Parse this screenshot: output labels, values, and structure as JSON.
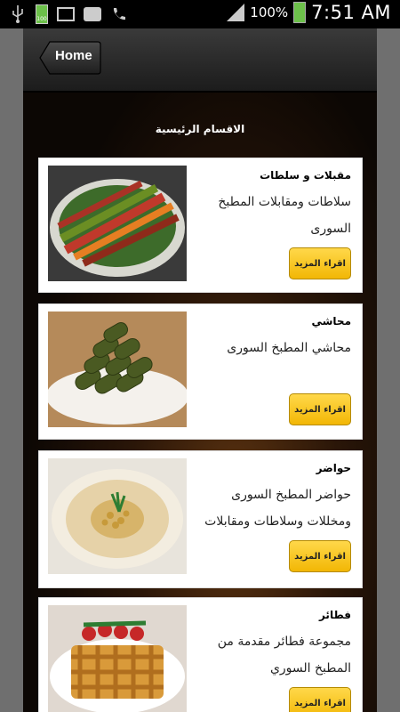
{
  "status_bar": {
    "battery_percent": "100%",
    "time": "7:51 AM",
    "small_battery_label": "100"
  },
  "header": {
    "home_label": "Home"
  },
  "section_title": "الاقسام الرئيسية",
  "categories": [
    {
      "title": "مقبلات و سلطات",
      "description": "سلاطات ومقابلات المطبخ السورى",
      "button": "اقراء المزيد",
      "image": "salad-platter"
    },
    {
      "title": "محاشي",
      "description": "محاشي المطبخ السورى",
      "button": "اقراء المزيد",
      "image": "stuffed-grape-leaves"
    },
    {
      "title": "حواضر",
      "description": "حواضر المطبخ السورى ومخللات وسلاطات ومقابلات",
      "button": "اقراء المزيد",
      "image": "hummus-plate"
    },
    {
      "title": "فطائر",
      "description": "مجموعة فطائر مقدمة من المطبخ السوري",
      "button": "اقراء المزيد",
      "image": "lattice-pie"
    }
  ],
  "colors": {
    "button_yellow": "#f2b705",
    "header_dark": "#2a2a2a",
    "frame_gray": "#6f6f6f"
  }
}
